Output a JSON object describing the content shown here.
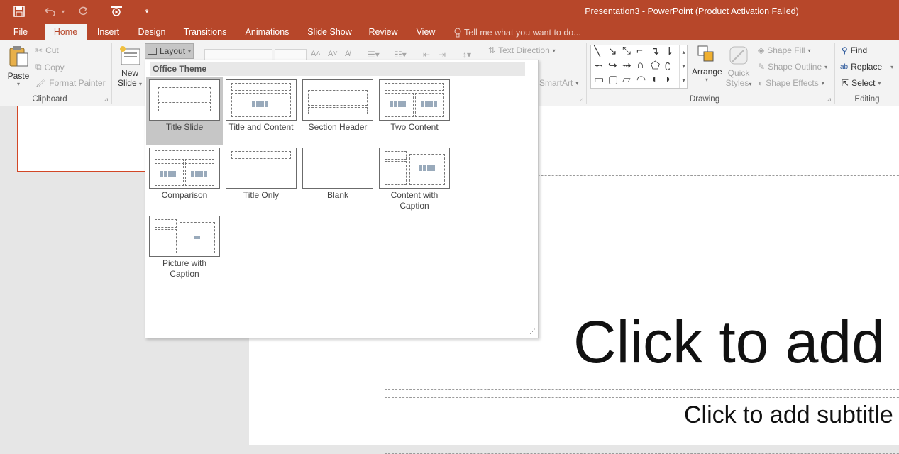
{
  "window": {
    "title": "Presentation3 - PowerPoint (Product Activation Failed)"
  },
  "qat": {
    "save_icon": "save-icon",
    "undo_icon": "undo-icon",
    "redo_icon": "redo-icon",
    "present_icon": "present-from-start-icon",
    "customize_icon": "customize-qat-icon"
  },
  "tabs": [
    {
      "label": "File"
    },
    {
      "label": "Home"
    },
    {
      "label": "Insert"
    },
    {
      "label": "Design"
    },
    {
      "label": "Transitions"
    },
    {
      "label": "Animations"
    },
    {
      "label": "Slide Show"
    },
    {
      "label": "Review"
    },
    {
      "label": "View"
    }
  ],
  "tell_me": {
    "placeholder": "Tell me what you want to do..."
  },
  "clipboard": {
    "paste": "Paste",
    "cut": "Cut",
    "copy": "Copy",
    "format_painter": "Format Painter",
    "group": "Clipboard"
  },
  "slides": {
    "new_slide": "New",
    "new_slide2": "Slide",
    "layout": "Layout"
  },
  "paragraph": {
    "text_direction": "Text Direction",
    "smartart": "SmartArt"
  },
  "drawing": {
    "arrange": "Arrange",
    "quick_styles": "Quick",
    "quick_styles2": "Styles",
    "shape_fill": "Shape Fill",
    "shape_outline": "Shape Outline",
    "shape_effects": "Shape Effects",
    "group": "Drawing"
  },
  "editing": {
    "find": "Find",
    "replace": "Replace",
    "select": "Select",
    "group": "Editing"
  },
  "gallery": {
    "header": "Office Theme",
    "layouts": [
      {
        "name": "Title Slide"
      },
      {
        "name": "Title and Content"
      },
      {
        "name": "Section Header"
      },
      {
        "name": "Two Content"
      },
      {
        "name": "Comparison"
      },
      {
        "name": "Title Only"
      },
      {
        "name": "Blank"
      },
      {
        "name": "Content with Caption"
      },
      {
        "name": "Picture with Caption"
      }
    ]
  },
  "slide": {
    "title": "Click to add",
    "subtitle": "Click to add subtitle"
  },
  "colors": {
    "accent": "#b7472a",
    "selected_thumb_border": "#d24726"
  }
}
